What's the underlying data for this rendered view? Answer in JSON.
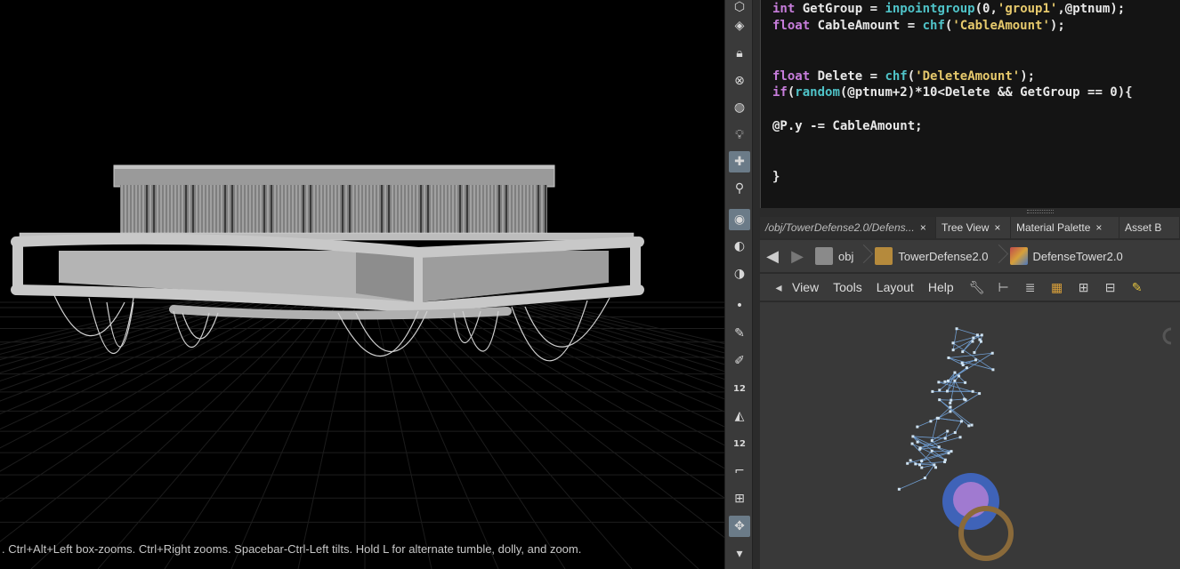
{
  "viewport": {
    "hint": ". Ctrl+Alt+Left box-zooms. Ctrl+Right zooms. Spacebar-Ctrl-Left tilts. Hold L for alternate tumble, dolly, and zoom."
  },
  "toolbar": {
    "icons": [
      "select-icon",
      "view-icon",
      "lock-icon",
      "handle-icon",
      "ghost-icon",
      "light-icon",
      "light-add-icon",
      "camera-pin-icon",
      "camera-icon",
      "display-icon",
      "snap-icon"
    ],
    "badges": {
      "points": "12",
      "prims": "12"
    }
  },
  "code": {
    "lines": [
      [
        {
          "t": "int",
          "c": "kw"
        },
        {
          "t": " GetGroup = ",
          "c": ""
        },
        {
          "t": "inpointgroup",
          "c": "fn"
        },
        {
          "t": "(0,",
          "c": ""
        },
        {
          "t": "'group1'",
          "c": "str"
        },
        {
          "t": ",@ptnum);",
          "c": ""
        }
      ],
      [
        {
          "t": "float",
          "c": "kw"
        },
        {
          "t": " CableAmount = ",
          "c": ""
        },
        {
          "t": "chf",
          "c": "fn"
        },
        {
          "t": "(",
          "c": ""
        },
        {
          "t": "'CableAmount'",
          "c": "str"
        },
        {
          "t": ");",
          "c": ""
        }
      ],
      [],
      [],
      [
        {
          "t": "float",
          "c": "kw"
        },
        {
          "t": " Delete = ",
          "c": ""
        },
        {
          "t": "chf",
          "c": "fn"
        },
        {
          "t": "(",
          "c": ""
        },
        {
          "t": "'DeleteAmount'",
          "c": "str"
        },
        {
          "t": ");",
          "c": ""
        }
      ],
      [
        {
          "t": "if",
          "c": "kw"
        },
        {
          "t": "(",
          "c": ""
        },
        {
          "t": "random",
          "c": "fn"
        },
        {
          "t": "(@ptnum+2)*10<Delete && GetGroup == 0){",
          "c": ""
        }
      ],
      [],
      [
        {
          "t": "@P.y -= CableAmount;",
          "c": ""
        }
      ],
      [],
      [],
      [
        {
          "t": "}",
          "c": ""
        }
      ]
    ]
  },
  "tabs": [
    {
      "label": "/obj/TowerDefense2.0/Defens...",
      "close": "×"
    },
    {
      "label": "Tree View",
      "close": "×"
    },
    {
      "label": "Material Palette",
      "close": "×"
    },
    {
      "label": "Asset B",
      "close": ""
    }
  ],
  "path": {
    "crumbs": [
      {
        "label": "obj",
        "color": "#8a8a8a"
      },
      {
        "label": "TowerDefense2.0",
        "color": "#b58a3c"
      },
      {
        "label": "DefenseTower2.0",
        "color": "#c04a4a"
      }
    ]
  },
  "netmenu": {
    "items": [
      "View",
      "Tools",
      "Layout",
      "Help"
    ]
  }
}
